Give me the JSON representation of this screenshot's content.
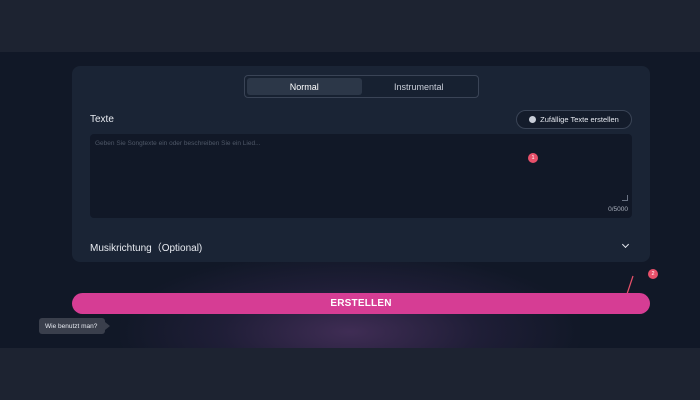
{
  "mode_tabs": [
    {
      "label": "Normal",
      "active": true
    },
    {
      "label": "Instrumental",
      "active": false
    }
  ],
  "lyrics": {
    "label": "Texte",
    "random_button": "Zufällige Texte erstellen",
    "random_icon": "dice-icon",
    "placeholder": "Geben Sie Songtexte ein oder beschreiben Sie ein Lied...",
    "counter": "0/5000"
  },
  "music_style": {
    "label": "Musikrichtung（Optional)",
    "icon": "chevron-down-icon"
  },
  "create_button": "ERSTELLEN",
  "help_button": "Wie benutzt man?",
  "markers": [
    "1",
    "2"
  ],
  "colors": {
    "accent": "#d63d94",
    "marker": "#e8506a",
    "card": "#1a2435",
    "background": "#111827"
  }
}
